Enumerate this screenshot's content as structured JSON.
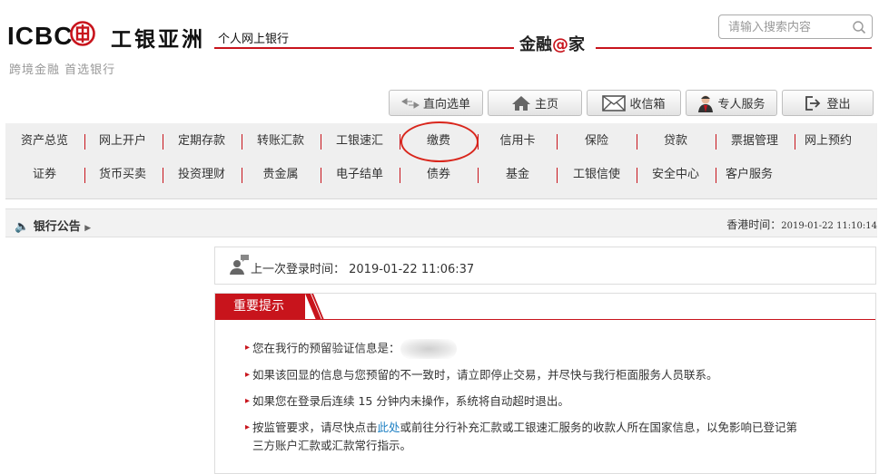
{
  "header": {
    "logo_en": "ICBC",
    "logo_cn": "工银亚洲",
    "slogan": "跨境金融 首选银行",
    "app_title": "个人网上银行",
    "brand_a": "金融",
    "brand_at": "@",
    "brand_b": "家",
    "search_placeholder": "请输入搜索内容"
  },
  "toolbar": {
    "menu": "直向选单",
    "home": "主页",
    "inbox": "收信箱",
    "advisor": "专人服务",
    "logout": "登出"
  },
  "nav": {
    "row1": [
      "资产总览",
      "网上开户",
      "定期存款",
      "转账汇款",
      "工银速汇",
      "缴费",
      "信用卡",
      "保险",
      "贷款",
      "票据管理",
      "网上预约"
    ],
    "row2": [
      "证券",
      "货币买卖",
      "投资理财",
      "贵金属",
      "电子结单",
      "债券",
      "基金",
      "工银信使",
      "安全中心",
      "客户服务"
    ]
  },
  "notice": {
    "label": "银行公告",
    "time_label": "香港时间：",
    "time_value": "2019-01-22 11:10:14"
  },
  "login": {
    "text": "上一次登录时间： 2019-01-22 11:06:37"
  },
  "tips": {
    "title": "重要提示",
    "t1": "您在我行的预留验证信息是：",
    "t2": "如果该回显的信息与您预留的不一致时，请立即停止交易，并尽快与我行柜面服务人员联系。",
    "t3": "如果您在登录后连续 15 分钟内未操作，系统将自动超时退出。",
    "t4_a": "按监管要求，请尽快点击",
    "t4_link": "此处",
    "t4_b": "或前往分行补充汇款或工银速汇服务的收款人所在国家信息，以免影响已登记第",
    "t4_c": "三方账户汇款或汇款常行指示。"
  },
  "colors": {
    "brand_red": "#c8141c",
    "link_blue": "#1a7ec2"
  }
}
